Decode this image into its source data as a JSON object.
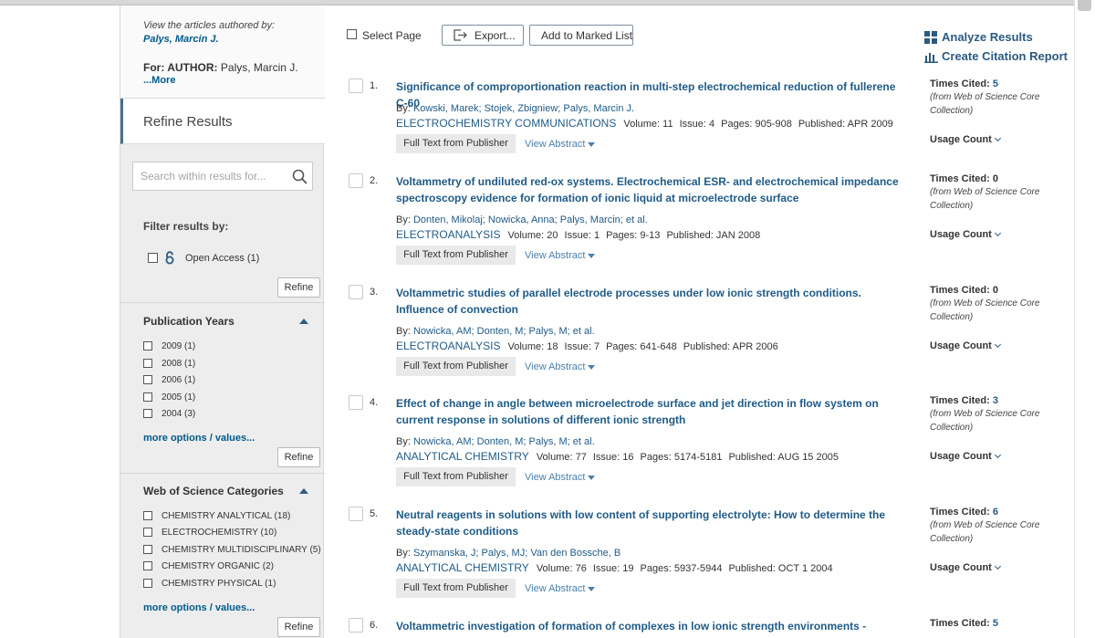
{
  "author_box": {
    "view_label": "View the articles authored by:",
    "author_name": "Palys, Marcin J.",
    "for_prefix": "For: AUTHOR:",
    "for_value": "Palys, Marcin J.",
    "more": "...More"
  },
  "refine": {
    "title": "Refine Results",
    "search_placeholder": "Search within results for...",
    "filter_label": "Filter results by:",
    "open_access": "Open Access (1)",
    "refine_label": "Refine"
  },
  "pub_years": {
    "title": "Publication Years",
    "options": [
      "2009 (1)",
      "2008 (1)",
      "2006 (1)",
      "2005 (1)",
      "2004 (3)"
    ],
    "more": "more options / values..."
  },
  "wos_categories": {
    "title": "Web of Science Categories",
    "options": [
      "CHEMISTRY ANALYTICAL (18)",
      "ELECTROCHEMISTRY (10)",
      "CHEMISTRY MULTIDISCIPLINARY (5)",
      "CHEMISTRY ORGANIC (2)",
      "CHEMISTRY PHYSICAL (1)"
    ],
    "more": "more options / values..."
  },
  "toolbar": {
    "select_page": "Select Page",
    "export": "Export...",
    "add_marked": "Add to Marked List",
    "analyze": "Analyze Results",
    "citation_report": "Create Citation Report"
  },
  "labels": {
    "by": "By:",
    "volume": "Volume:",
    "issue": "Issue:",
    "pages": "Pages:",
    "published": "Published:",
    "full_text": "Full Text from Publisher",
    "view_abstract": "View Abstract",
    "times_cited": "Times Cited:",
    "from_wos": "(from Web of Science Core Collection)",
    "usage_count": "Usage Count"
  },
  "records": [
    {
      "num": "1.",
      "title": "Significance of comproportionation reaction in multi-step electrochemical reduction of fullerene C-60",
      "authors": "Kowski, Marek; Stojek, Zbigniew; Palys, Marcin J.",
      "journal": "ELECTROCHEMISTRY COMMUNICATIONS",
      "volume": "11",
      "issue": "4",
      "pages": "905-908",
      "published": "APR 2009",
      "times_cited": "5"
    },
    {
      "num": "2.",
      "title": "Voltammetry of undiluted red-ox systems. Electrochemical ESR- and electrochemical impedance spectroscopy evidence for formation of ionic liquid at microelectrode surface",
      "authors": "Donten, Mikolaj; Nowicka, Anna; Palys, Marcin; et al.",
      "journal": "ELECTROANALYSIS",
      "volume": "20",
      "issue": "1",
      "pages": "9-13",
      "published": "JAN 2008",
      "times_cited": "0"
    },
    {
      "num": "3.",
      "title": "Voltammetric studies of parallel electrode processes under low ionic strength conditions. Influence of convection",
      "authors": "Nowicka, AM; Donten, M; Palys, M; et al.",
      "journal": "ELECTROANALYSIS",
      "volume": "18",
      "issue": "7",
      "pages": "641-648",
      "published": "APR 2006",
      "times_cited": "0"
    },
    {
      "num": "4.",
      "title": "Effect of change in angle between microelectrode surface and jet direction in flow system on current response in solutions of different ionic strength",
      "authors": "Nowicka, AM; Donten, M; Palys, M; et al.",
      "journal": "ANALYTICAL CHEMISTRY",
      "volume": "77",
      "issue": "16",
      "pages": "5174-5181",
      "published": "AUG 15 2005",
      "times_cited": "3"
    },
    {
      "num": "5.",
      "title": "Neutral reagents in solutions with low content of supporting electrolyte: How to determine the steady-state conditions",
      "authors": "Szymanska, J; Palys, MJ; Van den Bossche, B",
      "journal": "ANALYTICAL CHEMISTRY",
      "volume": "76",
      "issue": "19",
      "pages": "5937-5944",
      "published": "OCT 1 2004",
      "times_cited": "6"
    },
    {
      "num": "6.",
      "title": "Voltammetric investigation of formation of complexes in low ionic strength environments - Theoretical",
      "times_cited": "5"
    }
  ]
}
